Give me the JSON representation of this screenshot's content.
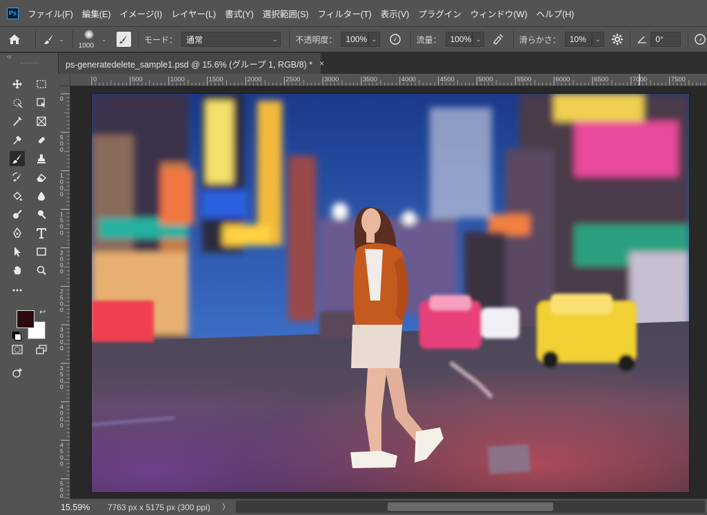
{
  "app": {
    "logo": "Ps"
  },
  "menu": [
    "ファイル(F)",
    "編集(E)",
    "イメージ(I)",
    "レイヤー(L)",
    "書式(Y)",
    "選択範囲(S)",
    "フィルター(T)",
    "表示(V)",
    "プラグイン",
    "ウィンドウ(W)",
    "ヘルプ(H)"
  ],
  "options": {
    "brush_size": "1000",
    "mode_label": "モード：",
    "mode_value": "通常",
    "opacity_label": "不透明度：",
    "opacity_value": "100%",
    "flow_label": "流量：",
    "flow_value": "100%",
    "smoothing_label": "滑らかさ：",
    "smoothing_value": "10%",
    "angle_value": "0°"
  },
  "document": {
    "tab_title": "ps-generatedelete_sample1.psd @ 15.6% (グループ 1, RGB/8) *",
    "close_glyph": "×"
  },
  "rulers": {
    "horizontal": [
      "0",
      "500",
      "1000",
      "1500",
      "2000",
      "2500",
      "3000",
      "3500",
      "4000",
      "4500",
      "5000",
      "5500",
      "6000",
      "6500",
      "7000",
      "7500"
    ],
    "vertical": [
      "0",
      "500",
      "1000",
      "1500",
      "2000",
      "2500",
      "3000",
      "3500",
      "4000",
      "4500",
      "5000"
    ]
  },
  "status": {
    "zoom": "15.59%",
    "doc_info": "7763 px x 5175 px (300 ppi)",
    "arrow": "〉"
  },
  "colors": {
    "foreground": "#2a0a0a",
    "background": "#ffffff",
    "accent": "#31a8ff"
  },
  "photo": {
    "description_icon": "street-photo"
  }
}
